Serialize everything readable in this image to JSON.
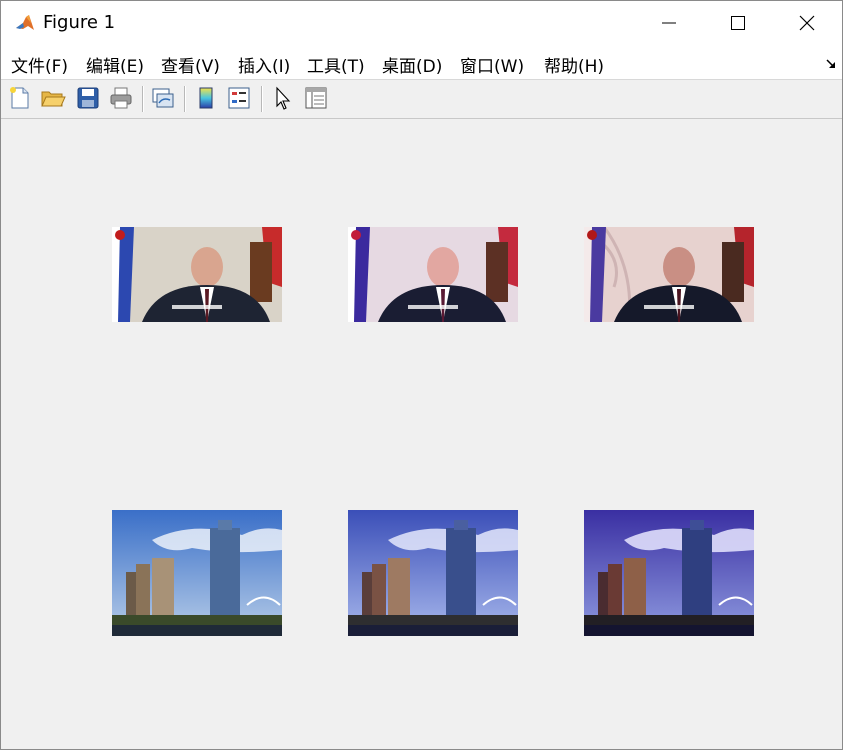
{
  "window": {
    "title": "Figure 1"
  },
  "menu": [
    "文件(F)",
    "编辑(E)",
    "查看(V)",
    "插入(I)",
    "工具(T)",
    "桌面(D)",
    "窗口(W)",
    "帮助(H)"
  ],
  "toolbar": {
    "icons": [
      "new-figure-icon",
      "open-file-icon",
      "save-icon",
      "print-icon",
      "link-plot-icon",
      "colorbar-icon",
      "legend-icon",
      "select-arrow-icon",
      "property-inspector-icon"
    ]
  },
  "axes": {
    "rows": [
      {
        "subject": "portrait",
        "variants": [
          "original",
          "enhanced-a",
          "enhanced-b"
        ]
      },
      {
        "subject": "city-skyline",
        "variants": [
          "original",
          "enhanced-a",
          "enhanced-b"
        ]
      }
    ]
  },
  "colors": {
    "frame_bg": "#f0f0f0",
    "titlebar_bg": "#ffffff"
  }
}
